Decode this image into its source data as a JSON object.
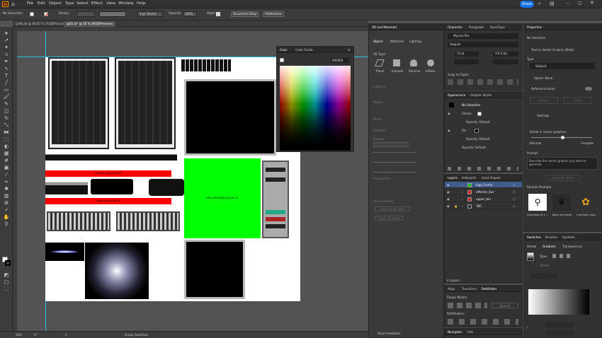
{
  "app": {
    "logo": "Ai",
    "home_icon": "home-icon"
  },
  "menu": [
    "File",
    "Edit",
    "Object",
    "Type",
    "Select",
    "Effect",
    "View",
    "Window",
    "Help"
  ],
  "share": "Share",
  "control": {
    "selection": "No Selection",
    "stroke_label": "Stroke",
    "stroke_style": "5 pt. Round",
    "opacity_label": "Opacity:",
    "opacity_value": "100%",
    "style_label": "Style:",
    "doc_setup": "Document Setup",
    "preferences": "Preferences"
  },
  "tabs": [
    "grMiLab @ 66.67 % (RGB/Preview)",
    "gdl2.ai* @ 50 % (RGB/Preview)"
  ],
  "status": {
    "zoom": "50%",
    "angle": "0°",
    "page": "1",
    "tool": "Group Selection"
  },
  "artboard": {
    "bar1": "effector_bar(0,0)00,0",
    "bar2": "upper_bar(0,0)00,0",
    "green": "RBA_frame(000,400,00,17)"
  },
  "color_panel": {
    "tabs": [
      "Color",
      "Color Guide"
    ],
    "hex": "000000"
  },
  "threeD": {
    "tabs": [
      "3D and Materials"
    ],
    "sub": [
      "Object",
      "Materials",
      "Lighting"
    ],
    "type_label": "3D Type",
    "types": [
      "Plane",
      "Extrude",
      "Revolve",
      "Inflate"
    ],
    "sections": [
      "Lighting",
      "Depth",
      "Bevel",
      "Rotation",
      "Presets",
      "Perspective",
      "Quick actions"
    ],
    "btn1": "Export as 3D object",
    "btn2": "Export 3D Object",
    "feedback": "Share feedback"
  },
  "character": {
    "tabs": [
      "Character",
      "Paragraph",
      "OpenType"
    ],
    "font": "Myriad Pro",
    "style": "Regular",
    "size": "12 pt",
    "leading": "(14.4 pt)",
    "snap": "Snap to Glyph"
  },
  "appearance": {
    "tabs": [
      "Appearance",
      "Graphic Styles"
    ],
    "title": "No Selection",
    "rows": [
      "Stroke:",
      "Opacity: Default",
      "Fill:",
      "Opacity: Default",
      "Opacity: Default"
    ]
  },
  "layers": {
    "tabs": [
      "Layers",
      "Artboards",
      "Asset Export"
    ],
    "items": [
      {
        "name": "logo_frame",
        "color": "#00c800"
      },
      {
        "name": "effector_bar",
        "color": "#e02020"
      },
      {
        "name": "upper_bar",
        "color": "#cc2020"
      },
      {
        "name": "TBC",
        "color": "#333333"
      }
    ],
    "count": "4 Layers"
  },
  "align": {
    "tabs": [
      "Align",
      "Transform",
      "Pathfinder"
    ],
    "shape_modes": "Shape Modes:",
    "expand": "Expand",
    "pathfinders": "Pathfinders:"
  },
  "navigator": {
    "tabs": [
      "Navigator",
      "Info"
    ]
  },
  "properties": {
    "title": "Properties",
    "selection": "No Selection",
    "generate": "Text to Vector Graphic (Beta)",
    "type_label": "Type",
    "type_value": "Subject",
    "styles_label": "Styles: None",
    "reference": "Reference Asset",
    "effects": "Effects",
    "color_tone": "Colour",
    "settings": "Settings",
    "detail": "Detail in vector graphics",
    "minimal": "Minimal",
    "complex": "Complex",
    "prompt_label": "Prompt",
    "prompt_placeholder": "Describe the vector graphic you want to generate",
    "gen_btn": "Generate (Beta)",
    "samples": "Sample Prompts",
    "sample_names": [
      "Illustration of a ...",
      "Black and white...",
      "Cute baby drag..."
    ]
  },
  "swatches": {
    "tabs": [
      "Swatches",
      "Brushes",
      "Symbols"
    ],
    "sub": [
      "Stroke",
      "Gradient",
      "Transparency"
    ],
    "type": "Type:",
    "stroke": "Stroke:"
  },
  "colors": {
    "accent": "#1473e6",
    "green": "#00ff00",
    "red": "#ff0000"
  }
}
